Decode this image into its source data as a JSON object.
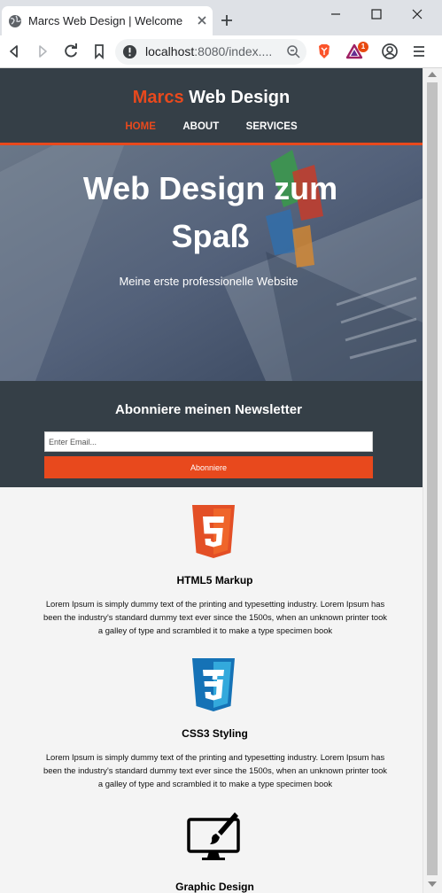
{
  "browser": {
    "tab_title": "Marcs Web Design | Welcome",
    "url_host": "localhost",
    "url_rest": ":8080/index....",
    "extension_badge": "1"
  },
  "site": {
    "brand_highlight": "Marcs",
    "brand_rest": " Web Design",
    "nav": [
      {
        "label": "HOME",
        "current": true
      },
      {
        "label": "ABOUT",
        "current": false
      },
      {
        "label": "SERVICES",
        "current": false
      }
    ],
    "accent_color": "#e8491d",
    "dark_color": "#353f47"
  },
  "hero": {
    "title_line1": "Web Design zum",
    "title_line2": "Spaß",
    "subtitle": "Meine erste professionelle Website"
  },
  "newsletter": {
    "heading": "Abonniere meinen Newsletter",
    "email_placeholder": "Enter Email...",
    "email_value": "",
    "button_label": "Abonniere"
  },
  "boxes": [
    {
      "icon": "html5-logo",
      "title": "HTML5 Markup",
      "text": "Lorem Ipsum is simply dummy text of the printing and typesetting industry. Lorem Ipsum has been the industry's standard dummy text ever since the 1500s, when an unknown printer took a galley of type and scrambled it to make a type specimen book"
    },
    {
      "icon": "css3-logo",
      "title": "CSS3 Styling",
      "text": "Lorem Ipsum is simply dummy text of the printing and typesetting industry. Lorem Ipsum has been the industry's standard dummy text ever since the 1500s, when an unknown printer took a galley of type and scrambled it to make a type specimen book"
    },
    {
      "icon": "monitor-brush-icon",
      "title": "Graphic Design"
    }
  ]
}
